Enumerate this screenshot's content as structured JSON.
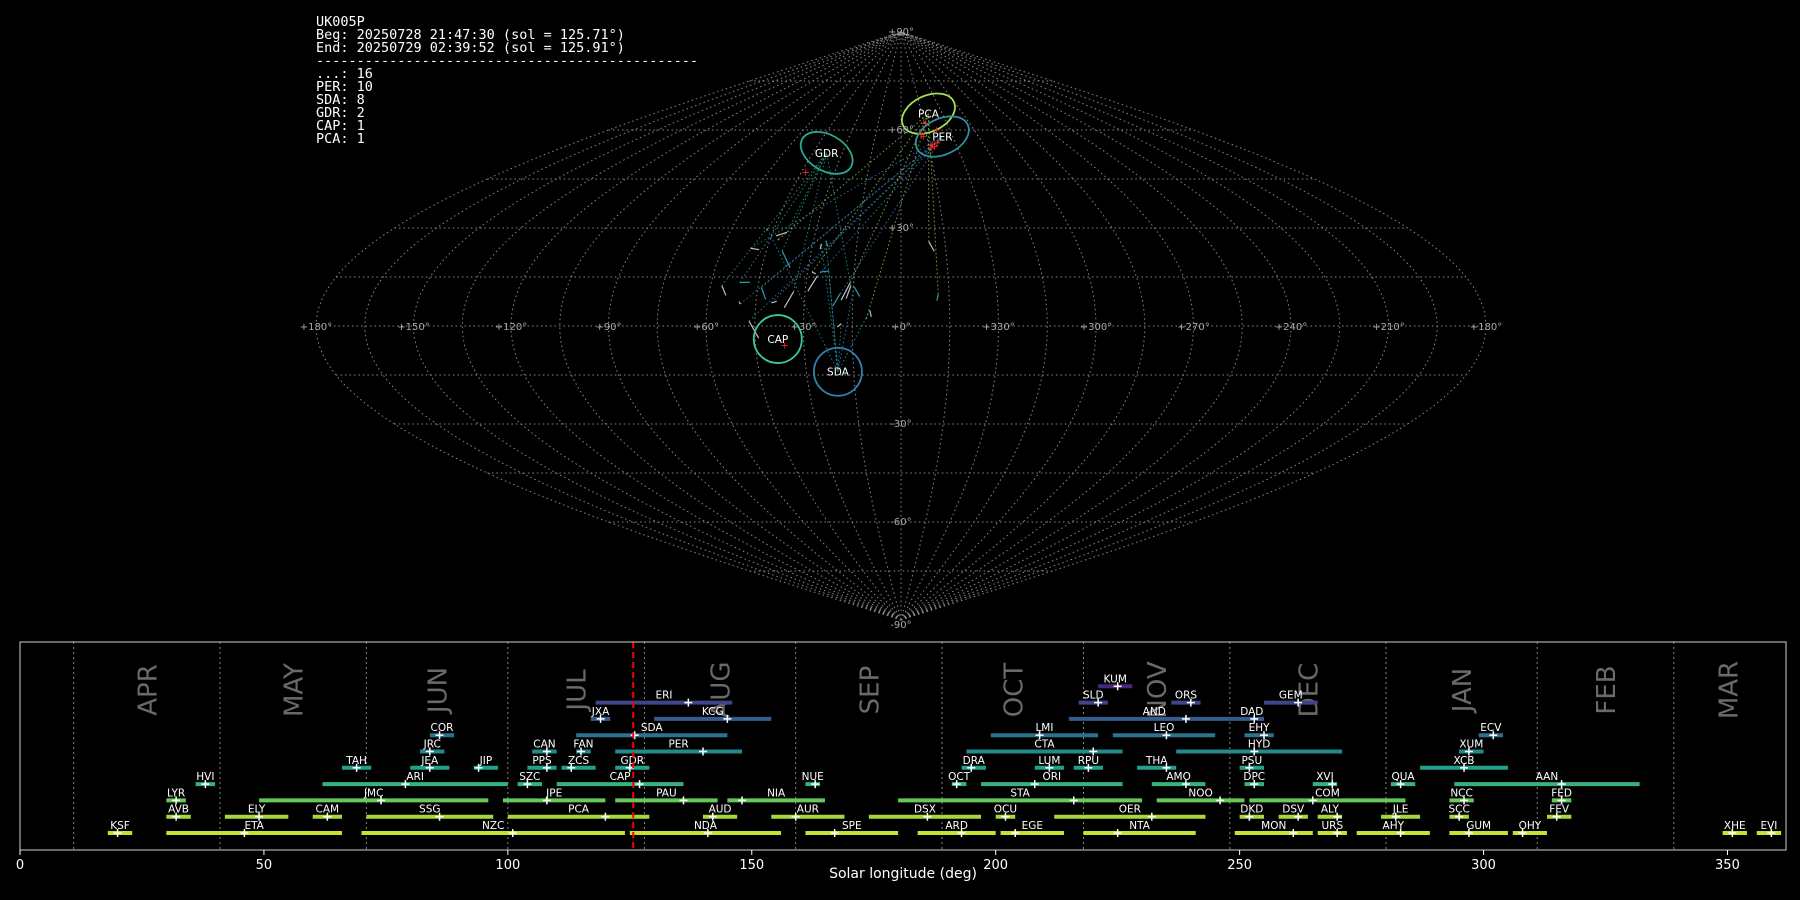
{
  "info": {
    "station": "UK005P",
    "beg": "Beg: 20250728 21:47:30 (sol = 125.71°)",
    "end": "End: 20250729 02:39:52 (sol = 125.91°)",
    "separator": "-----------------------------------------------",
    "counts": [
      "...: 16",
      "PER: 10",
      "SDA: 8",
      "GDR: 2",
      "CAP: 1",
      "PCA: 1"
    ]
  },
  "colors": {
    "background": "#000000",
    "grid": "#888888",
    "sol_marker": "#ff0000",
    "radiant_point": "#ff2020"
  },
  "chart_data": [
    {
      "type": "scatter",
      "projection": "sinusoidal",
      "lon_ticks": [
        "+180°",
        "+150°",
        "+120°",
        "+90°",
        "+60°",
        "+30°",
        "+0°",
        "+330°",
        "+300°",
        "+270°",
        "+240°",
        "+210°",
        "+180°"
      ],
      "lat_ticks": [
        "+90°",
        "+60°",
        "+30°",
        "-30°",
        "-60°",
        "-90°"
      ],
      "grid": true,
      "showers": [
        {
          "name": "PCA",
          "lon": 20,
          "lat": 65,
          "color": "#9fe05a",
          "count": 1
        },
        {
          "name": "PER",
          "lon": 24,
          "lat": 58,
          "color": "#2f8fa0",
          "count": 10
        },
        {
          "name": "GDR",
          "lon": -38,
          "lat": 53,
          "color": "#2aa890",
          "count": 2
        },
        {
          "name": "CAP",
          "lon": -38,
          "lat": -4,
          "color": "#3cc99a",
          "count": 1
        },
        {
          "name": "SDA",
          "lon": -20,
          "lat": -14,
          "color": "#3480b0",
          "count": 8
        }
      ],
      "radiants": [
        {
          "lon": 18,
          "lat": 55
        },
        {
          "lon": 17,
          "lat": 55.5
        },
        {
          "lon": 16,
          "lat": 54.5
        },
        {
          "lon": 20,
          "lat": 56
        },
        {
          "lon": 13,
          "lat": 58
        },
        {
          "lon": 12,
          "lat": 59
        },
        {
          "lon": 22,
          "lat": 60
        },
        {
          "lon": -43,
          "lat": 47
        },
        {
          "lon": -36,
          "lat": -6
        },
        {
          "lon": 16,
          "lat": 62
        }
      ]
    },
    {
      "type": "bar",
      "title": "",
      "xlabel": "Solar longitude (deg)",
      "ylabel": "",
      "xlim": [
        0,
        362
      ],
      "xticks": [
        "0",
        "50",
        "100",
        "150",
        "200",
        "250",
        "300",
        "350"
      ],
      "months": [
        "APR",
        "MAY",
        "JUN",
        "JUL",
        "AUG",
        "SEP",
        "OCT",
        "NOV",
        "DEC",
        "JAN",
        "FEB",
        "MAR"
      ],
      "sol_current": 125.71,
      "showers": [
        {
          "name": "KSF",
          "start": 18,
          "end": 23,
          "peak": 20,
          "row": 1
        },
        {
          "name": "ETA",
          "start": 30,
          "end": 66,
          "peak": 46,
          "row": 1
        },
        {
          "name": "NZC",
          "start": 70,
          "end": 124,
          "peak": 101,
          "row": 1
        },
        {
          "name": "NDA",
          "start": 125,
          "end": 156,
          "peak": 141,
          "row": 1
        },
        {
          "name": "SPE",
          "start": 161,
          "end": 180,
          "peak": 167,
          "row": 1
        },
        {
          "name": "ARD",
          "start": 184,
          "end": 200,
          "peak": 193,
          "row": 1
        },
        {
          "name": "EGE",
          "start": 201,
          "end": 214,
          "peak": 204,
          "row": 1
        },
        {
          "name": "NTA",
          "start": 218,
          "end": 241,
          "peak": 225,
          "row": 1
        },
        {
          "name": "MON",
          "start": 249,
          "end": 265,
          "peak": 261,
          "row": 1
        },
        {
          "name": "URS",
          "start": 266,
          "end": 272,
          "peak": 270,
          "row": 1
        },
        {
          "name": "AHY",
          "start": 274,
          "end": 289,
          "peak": 283,
          "row": 1
        },
        {
          "name": "GUM",
          "start": 293,
          "end": 305,
          "peak": 297,
          "row": 1
        },
        {
          "name": "OHY",
          "start": 306,
          "end": 313,
          "peak": 308,
          "row": 1
        },
        {
          "name": "XHE",
          "start": 349,
          "end": 354,
          "peak": 351,
          "row": 1
        },
        {
          "name": "EVI",
          "start": 356,
          "end": 361,
          "peak": 359,
          "row": 1
        },
        {
          "name": "AVB",
          "start": 30,
          "end": 35,
          "peak": 32,
          "row": 2
        },
        {
          "name": "ELY",
          "start": 42,
          "end": 55,
          "peak": 49,
          "row": 2
        },
        {
          "name": "CAM",
          "start": 60,
          "end": 66,
          "peak": 63,
          "row": 2
        },
        {
          "name": "SSG",
          "start": 71,
          "end": 97,
          "peak": 86,
          "row": 2
        },
        {
          "name": "PCA",
          "start": 100,
          "end": 129,
          "peak": 120,
          "row": 2
        },
        {
          "name": "AUD",
          "start": 140,
          "end": 147,
          "peak": 142,
          "row": 2
        },
        {
          "name": "AUR",
          "start": 154,
          "end": 169,
          "peak": 159,
          "row": 2
        },
        {
          "name": "DSX",
          "start": 174,
          "end": 197,
          "peak": 186,
          "row": 2
        },
        {
          "name": "OCU",
          "start": 200,
          "end": 204,
          "peak": 202,
          "row": 2
        },
        {
          "name": "OER",
          "start": 212,
          "end": 243,
          "peak": 232,
          "row": 2
        },
        {
          "name": "DKD",
          "start": 250,
          "end": 255,
          "peak": 252,
          "row": 2
        },
        {
          "name": "DSV",
          "start": 258,
          "end": 264,
          "peak": 262,
          "row": 2
        },
        {
          "name": "ALY",
          "start": 266,
          "end": 271,
          "peak": 270,
          "row": 2
        },
        {
          "name": "JLE",
          "start": 279,
          "end": 287,
          "peak": 282,
          "row": 2
        },
        {
          "name": "SCC",
          "start": 293,
          "end": 297,
          "peak": 295,
          "row": 2
        },
        {
          "name": "FEV",
          "start": 313,
          "end": 318,
          "peak": 315,
          "row": 2
        },
        {
          "name": "LYR",
          "start": 30,
          "end": 34,
          "peak": 32,
          "row": 3
        },
        {
          "name": "JMC",
          "start": 49,
          "end": 96,
          "peak": 74,
          "row": 3
        },
        {
          "name": "JPE",
          "start": 99,
          "end": 120,
          "peak": 108,
          "row": 3
        },
        {
          "name": "PAU",
          "start": 122,
          "end": 143,
          "peak": 136,
          "row": 3
        },
        {
          "name": "NIA",
          "start": 145,
          "end": 165,
          "peak": 148,
          "row": 3
        },
        {
          "name": "STA",
          "start": 180,
          "end": 230,
          "peak": 216,
          "row": 3
        },
        {
          "name": "NOO",
          "start": 233,
          "end": 251,
          "peak": 246,
          "row": 3
        },
        {
          "name": "COM",
          "start": 252,
          "end": 284,
          "peak": 265,
          "row": 3
        },
        {
          "name": "NCC",
          "start": 293,
          "end": 298,
          "peak": 296,
          "row": 3
        },
        {
          "name": "FED",
          "start": 314,
          "end": 318,
          "peak": 316,
          "row": 3
        },
        {
          "name": "HVI",
          "start": 36,
          "end": 40,
          "peak": 38,
          "row": 4
        },
        {
          "name": "ARI",
          "start": 62,
          "end": 100,
          "peak": 79,
          "row": 4
        },
        {
          "name": "SZC",
          "start": 102,
          "end": 107,
          "peak": 104,
          "row": 4
        },
        {
          "name": "CAP",
          "start": 110,
          "end": 136,
          "peak": 127,
          "row": 4
        },
        {
          "name": "NUE",
          "start": 161,
          "end": 164,
          "peak": 163,
          "row": 4
        },
        {
          "name": "OCT",
          "start": 191,
          "end": 194,
          "peak": 192,
          "row": 4
        },
        {
          "name": "ORI",
          "start": 197,
          "end": 226,
          "peak": 208,
          "row": 4
        },
        {
          "name": "AMO",
          "start": 232,
          "end": 243,
          "peak": 239,
          "row": 4
        },
        {
          "name": "DPC",
          "start": 251,
          "end": 255,
          "peak": 253,
          "row": 4
        },
        {
          "name": "XVI",
          "start": 265,
          "end": 270,
          "peak": 269,
          "row": 4
        },
        {
          "name": "QUA",
          "start": 281,
          "end": 286,
          "peak": 283,
          "row": 4
        },
        {
          "name": "AAN",
          "start": 294,
          "end": 332,
          "peak": 316,
          "row": 4
        },
        {
          "name": "TAH",
          "start": 66,
          "end": 72,
          "peak": 69,
          "row": 5
        },
        {
          "name": "JEA",
          "start": 80,
          "end": 88,
          "peak": 84,
          "row": 5
        },
        {
          "name": "JIP",
          "start": 93,
          "end": 98,
          "peak": 94,
          "row": 5
        },
        {
          "name": "PPS",
          "start": 104,
          "end": 110,
          "peak": 108,
          "row": 5
        },
        {
          "name": "ZCS",
          "start": 111,
          "end": 118,
          "peak": 113,
          "row": 5
        },
        {
          "name": "GDR",
          "start": 122,
          "end": 129,
          "peak": 125,
          "row": 5
        },
        {
          "name": "DRA",
          "start": 193,
          "end": 198,
          "peak": 195,
          "row": 5
        },
        {
          "name": "LUM",
          "start": 208,
          "end": 214,
          "peak": 211,
          "row": 5
        },
        {
          "name": "RPU",
          "start": 216,
          "end": 222,
          "peak": 219,
          "row": 5
        },
        {
          "name": "THA",
          "start": 229,
          "end": 237,
          "peak": 235,
          "row": 5
        },
        {
          "name": "PSU",
          "start": 250,
          "end": 255,
          "peak": 252,
          "row": 5
        },
        {
          "name": "XCB",
          "start": 287,
          "end": 305,
          "peak": 296,
          "row": 5
        },
        {
          "name": "JRC",
          "start": 82,
          "end": 87,
          "peak": 84,
          "row": 6
        },
        {
          "name": "CAN",
          "start": 105,
          "end": 110,
          "peak": 108,
          "row": 6
        },
        {
          "name": "FAN",
          "start": 114,
          "end": 117,
          "peak": 115,
          "row": 6
        },
        {
          "name": "PER",
          "start": 122,
          "end": 148,
          "peak": 140,
          "row": 6
        },
        {
          "name": "CTA",
          "start": 194,
          "end": 226,
          "peak": 220,
          "row": 6
        },
        {
          "name": "HYD",
          "start": 237,
          "end": 271,
          "peak": 253,
          "row": 6
        },
        {
          "name": "XUM",
          "start": 295,
          "end": 300,
          "peak": 297,
          "row": 6
        },
        {
          "name": "COR",
          "start": 84,
          "end": 89,
          "peak": 86,
          "row": 7
        },
        {
          "name": "SDA",
          "start": 114,
          "end": 145,
          "peak": 126,
          "row": 7
        },
        {
          "name": "LMI",
          "start": 199,
          "end": 221,
          "peak": 209,
          "row": 7
        },
        {
          "name": "LEO",
          "start": 224,
          "end": 245,
          "peak": 235,
          "row": 7
        },
        {
          "name": "EHY",
          "start": 251,
          "end": 257,
          "peak": 255,
          "row": 7
        },
        {
          "name": "ECV",
          "start": 299,
          "end": 304,
          "peak": 302,
          "row": 7
        },
        {
          "name": "JXA",
          "start": 117,
          "end": 121,
          "peak": 119,
          "row": 8
        },
        {
          "name": "KCG",
          "start": 130,
          "end": 154,
          "peak": 145,
          "row": 8
        },
        {
          "name": "AND",
          "start": 215,
          "end": 250,
          "peak": 239,
          "row": 8
        },
        {
          "name": "DAD",
          "start": 250,
          "end": 255,
          "peak": 253,
          "row": 8
        },
        {
          "name": "ERI",
          "start": 118,
          "end": 146,
          "peak": 137,
          "row": 9
        },
        {
          "name": "SLD",
          "start": 217,
          "end": 223,
          "peak": 221,
          "row": 9
        },
        {
          "name": "ORS",
          "start": 236,
          "end": 242,
          "peak": 240,
          "row": 9
        },
        {
          "name": "GEM",
          "start": 255,
          "end": 266,
          "peak": 262,
          "row": 9
        },
        {
          "name": "KUM",
          "start": 221,
          "end": 228,
          "peak": 225,
          "row": 10
        }
      ]
    }
  ]
}
